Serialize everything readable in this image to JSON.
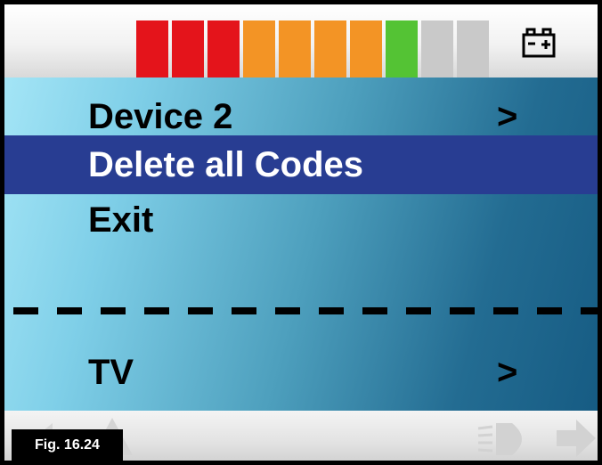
{
  "battery": {
    "charge_segments_lit": 8,
    "charge_segments_total": 10,
    "segment_colors": [
      "#e4141b",
      "#e4141b",
      "#e4141b",
      "#f39425",
      "#f39425",
      "#f39425",
      "#f39425",
      "#54c334",
      "#c9c9c9",
      "#c9c9c9"
    ]
  },
  "menu": {
    "items": [
      {
        "label": "Device 2",
        "arrow": ">",
        "selected": false
      },
      {
        "label": "Delete all Codes",
        "arrow": "",
        "selected": true
      },
      {
        "label": "Exit",
        "arrow": "",
        "selected": false
      }
    ],
    "footer_item": {
      "label": "TV",
      "arrow": ">"
    }
  },
  "figure_label": "Fig. 16.24",
  "colors": {
    "selection": "#283d92",
    "background_light": "#a9e8f8",
    "background_dark": "#155a82"
  },
  "icons": [
    "battery-icon",
    "nav-left-icon",
    "nav-up-icon",
    "light-icon",
    "nav-right-icon"
  ]
}
